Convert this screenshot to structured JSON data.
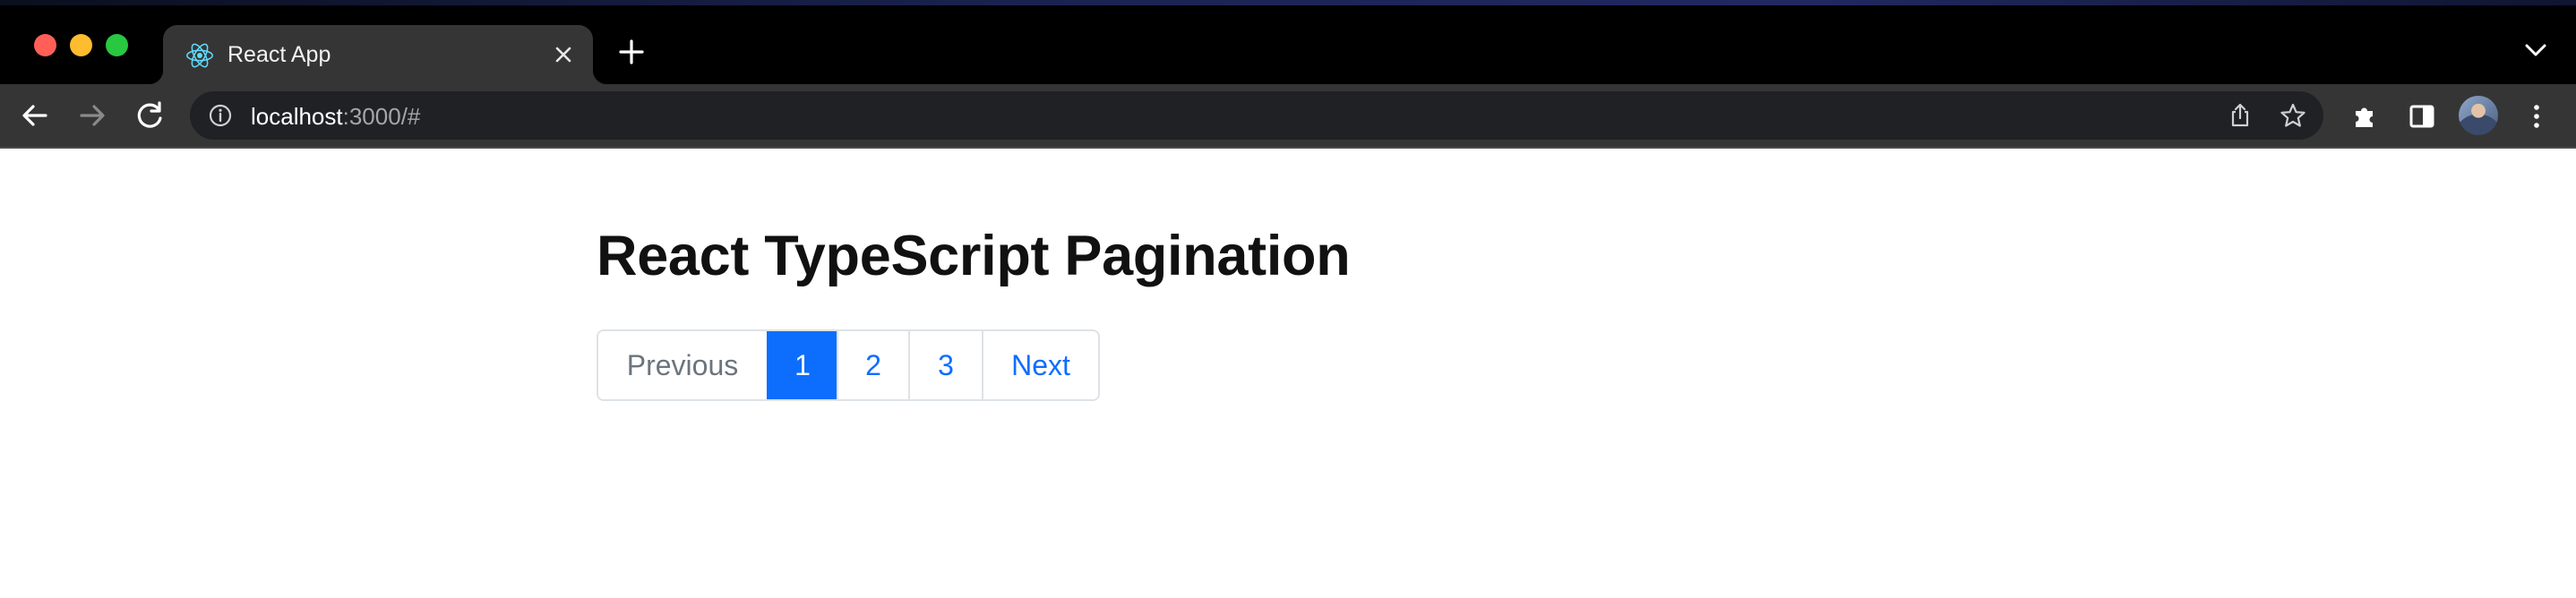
{
  "browser": {
    "tab": {
      "title": "React App",
      "favicon": "react-logo-icon"
    },
    "address_bar": {
      "host": "localhost",
      "path": ":3000/#"
    },
    "icons": {
      "back": "arrow-left-icon",
      "forward": "arrow-right-icon",
      "reload": "reload-icon",
      "info": "info-icon",
      "share": "share-icon",
      "bookmark": "star-icon",
      "extensions": "puzzle-icon",
      "side_panel": "side-panel-icon",
      "menu": "kebab-menu-icon",
      "new_tab": "plus-icon",
      "close_tab": "close-icon",
      "tab_search": "chevron-down-icon"
    },
    "window_controls": {
      "close_color": "#ff5f57",
      "minimize_color": "#febc2e",
      "maximize_color": "#28c840"
    }
  },
  "page": {
    "title": "React TypeScript Pagination",
    "pagination": {
      "previous_label": "Previous",
      "pages": [
        "1",
        "2",
        "3"
      ],
      "active_page": "1",
      "next_label": "Next",
      "accent_color": "#0d6efd",
      "disabled_color": "#6c757d"
    }
  }
}
